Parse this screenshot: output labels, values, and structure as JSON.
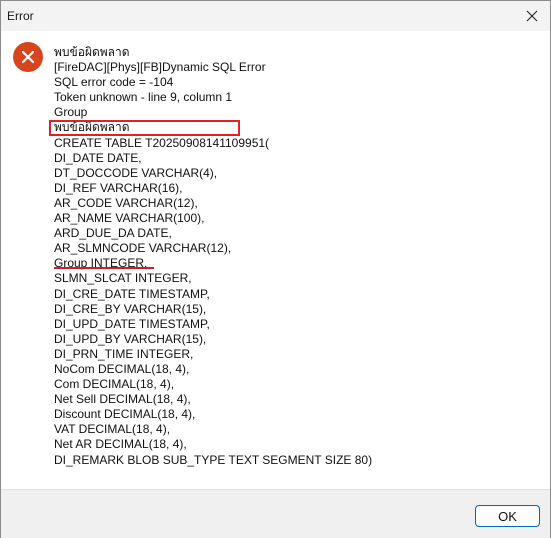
{
  "window": {
    "title": "Error"
  },
  "icons": {
    "close": "close-icon",
    "error": "error-icon"
  },
  "colors": {
    "error_icon": "#d7451f",
    "highlight": "#e0212a",
    "ok_border": "#0067c0"
  },
  "message": {
    "lines": [
      "พบข้อผิดพลาด",
      "[FireDAC][Phys][FB]Dynamic SQL Error",
      "SQL error code = -104",
      "Token unknown - line 9, column 1",
      "Group",
      "พบข้อผิดพลาด",
      "CREATE TABLE T20250908141109951(",
      "DI_DATE DATE,",
      "DT_DOCCODE VARCHAR(4),",
      "DI_REF VARCHAR(16),",
      "AR_CODE VARCHAR(12),",
      "AR_NAME VARCHAR(100),",
      "ARD_DUE_DA DATE,",
      "AR_SLMNCODE VARCHAR(12),",
      "Group INTEGER,",
      "SLMN_SLCAT INTEGER,",
      "DI_CRE_DATE TIMESTAMP,",
      "DI_CRE_BY VARCHAR(15),",
      "DI_UPD_DATE TIMESTAMP,",
      "DI_UPD_BY VARCHAR(15),",
      "DI_PRN_TIME INTEGER,",
      "NoCom DECIMAL(18, 4),",
      "Com DECIMAL(18, 4),",
      "Net Sell DECIMAL(18, 4),",
      "Discount DECIMAL(18, 4),",
      "VAT DECIMAL(18, 4),",
      "Net AR DECIMAL(18, 4),",
      "DI_REMARK BLOB SUB_TYPE TEXT SEGMENT SIZE 80)"
    ]
  },
  "buttons": {
    "ok": "OK"
  }
}
